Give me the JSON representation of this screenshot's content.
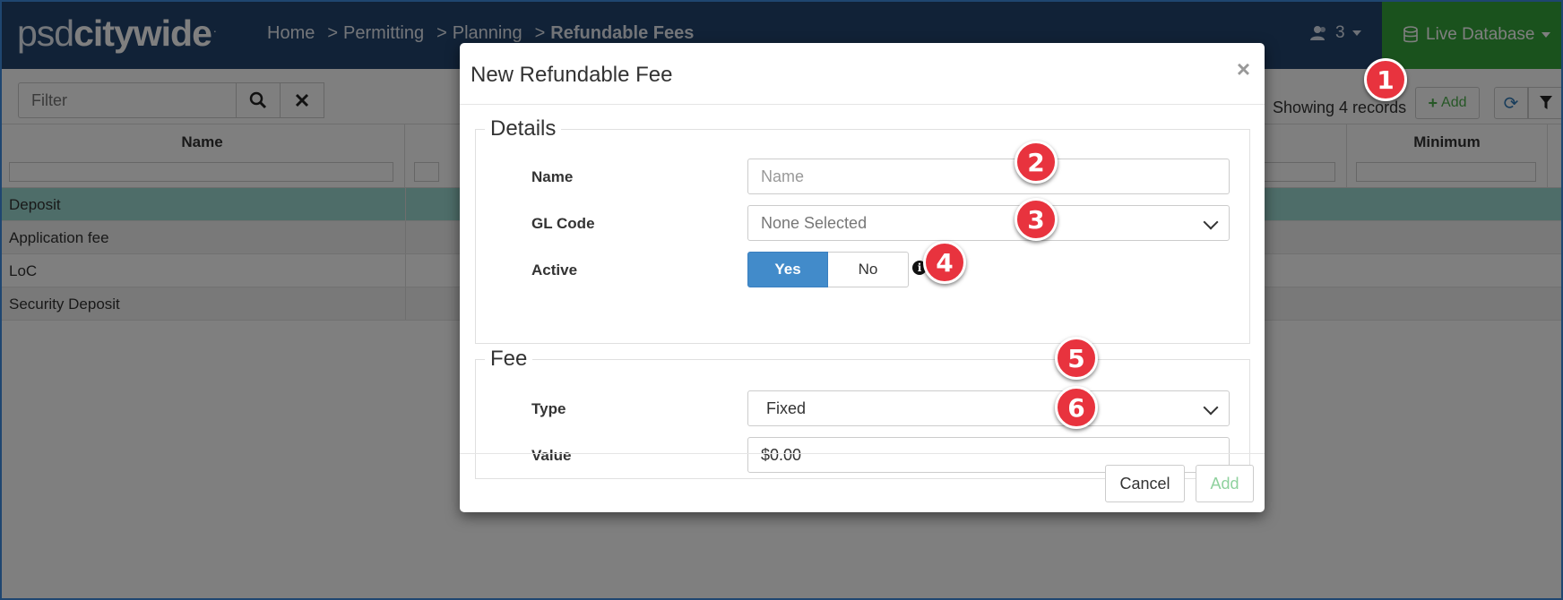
{
  "app": {
    "logo_light": "psd",
    "logo_bold": "citywide",
    "logo_mark": "."
  },
  "breadcrumb": {
    "items": [
      "Home",
      "Permitting",
      "Planning",
      "Refundable Fees"
    ],
    "separator": ">"
  },
  "header": {
    "users_count": "3",
    "database_label": "Live Database"
  },
  "toolbar": {
    "filter_placeholder": "Filter",
    "records_text": "Showing 4 records",
    "add_label": "Add"
  },
  "table": {
    "columns": [
      "Name",
      "Minimum"
    ],
    "rows": [
      "Deposit",
      "Application fee",
      "LoC",
      "Security Deposit"
    ]
  },
  "modal": {
    "title": "New Refundable Fee",
    "details": {
      "legend": "Details",
      "name_label": "Name",
      "name_placeholder": "Name",
      "gl_label": "GL Code",
      "gl_value": "None Selected",
      "active_label": "Active",
      "active_yes": "Yes",
      "active_no": "No"
    },
    "fee": {
      "legend": "Fee",
      "type_label": "Type",
      "type_value": "Fixed",
      "value_label": "Value",
      "value_value": "$0.00"
    },
    "cancel_label": "Cancel",
    "add_label": "Add"
  },
  "callouts": [
    "1",
    "2",
    "3",
    "4",
    "5",
    "6"
  ],
  "colors": {
    "nav": "#22456f",
    "live_db": "#35a53a",
    "selected_row": "#9ddbd3",
    "primary": "#428bca",
    "callout": "#e8333e"
  }
}
